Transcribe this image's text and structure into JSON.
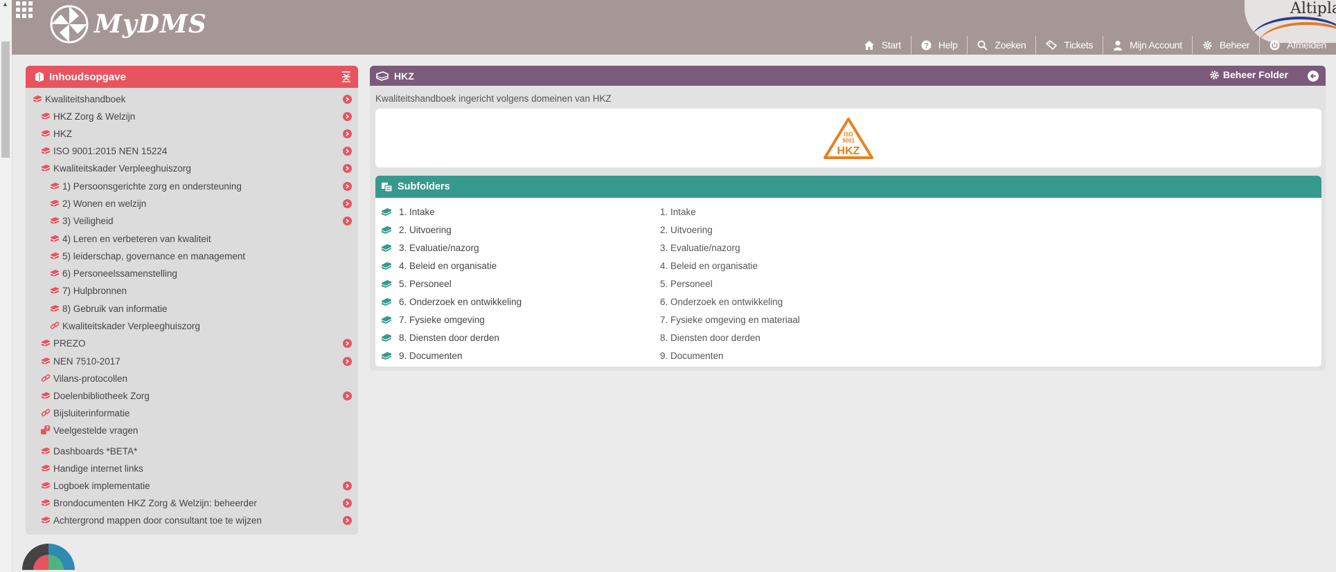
{
  "app": {
    "name": "MyDMS",
    "partner": "Altiplano"
  },
  "nav": [
    {
      "label": "Start",
      "icon": "home-icon"
    },
    {
      "label": "Help",
      "icon": "help-icon"
    },
    {
      "label": "Zoeken",
      "icon": "search-icon"
    },
    {
      "label": "Tickets",
      "icon": "ticket-icon"
    },
    {
      "label": "Mijn Account",
      "icon": "user-icon"
    },
    {
      "label": "Beheer",
      "icon": "gear-icon"
    },
    {
      "label": "Afmelden",
      "icon": "power-icon"
    }
  ],
  "toc": {
    "title": "Inhoudsopgave",
    "items": [
      {
        "label": "Kwaliteitshandboek",
        "level": 0,
        "icon": "book-icon",
        "arrow": true
      },
      {
        "label": "HKZ Zorg & Welzijn",
        "level": 1,
        "icon": "book-icon",
        "arrow": true
      },
      {
        "label": "HKZ",
        "level": 1,
        "icon": "book-icon",
        "arrow": true
      },
      {
        "label": "ISO 9001:2015 NEN 15224",
        "level": 1,
        "icon": "book-icon",
        "arrow": true
      },
      {
        "label": "Kwaliteitskader Verpleeghuiszorg",
        "level": 1,
        "icon": "book-icon",
        "arrow": true
      },
      {
        "label": "1) Persoonsgerichte zorg en ondersteuning",
        "level": 2,
        "icon": "book-icon",
        "arrow": true
      },
      {
        "label": "2) Wonen en welzijn",
        "level": 2,
        "icon": "book-icon",
        "arrow": true
      },
      {
        "label": "3) Veiligheid",
        "level": 2,
        "icon": "book-icon",
        "arrow": true
      },
      {
        "label": "4) Leren en verbeteren van kwaliteit",
        "level": 2,
        "icon": "book-icon",
        "arrow": false
      },
      {
        "label": "5) leiderschap, governance en management",
        "level": 2,
        "icon": "book-icon",
        "arrow": false
      },
      {
        "label": "6) Personeelssamenstelling",
        "level": 2,
        "icon": "book-icon",
        "arrow": false
      },
      {
        "label": "7) Hulpbronnen",
        "level": 2,
        "icon": "book-icon",
        "arrow": false
      },
      {
        "label": "8) Gebruik van informatie",
        "level": 2,
        "icon": "book-icon",
        "arrow": false
      },
      {
        "label": "Kwaliteitskader Verpleeghuiszorg",
        "level": 2,
        "icon": "link-icon",
        "arrow": false
      },
      {
        "label": "PREZO",
        "level": 1,
        "icon": "book-icon",
        "arrow": true
      },
      {
        "label": "NEN 7510-2017",
        "level": 1,
        "icon": "book-icon",
        "arrow": true
      },
      {
        "label": "Vilans-protocollen",
        "level": 1,
        "icon": "link-icon",
        "arrow": false
      },
      {
        "label": "Doelenbibliotheek Zorg",
        "level": 1,
        "icon": "book-icon",
        "arrow": true
      },
      {
        "label": "Bijsluiterinformatie",
        "level": 1,
        "icon": "link-icon",
        "arrow": false
      },
      {
        "label": "Veelgestelde vragen",
        "level": 1,
        "icon": "faq-icon",
        "arrow": false
      },
      {
        "label": "Dashboards *BETA*",
        "level": 1,
        "icon": "book-icon",
        "arrow": false
      },
      {
        "label": "Handige internet links",
        "level": 1,
        "icon": "book-icon",
        "arrow": false
      },
      {
        "label": "Logboek implementatie",
        "level": 1,
        "icon": "book-icon",
        "arrow": true
      },
      {
        "label": "Brondocumenten HKZ Zorg & Welzijn: beheerder",
        "level": 1,
        "icon": "book-icon",
        "arrow": true
      },
      {
        "label": "Achtergrond mappen door consultant toe te wijzen",
        "level": 1,
        "icon": "book-icon",
        "arrow": true
      }
    ]
  },
  "folder": {
    "title": "HKZ",
    "manage_label": "Beheer Folder",
    "description": "Kwaliteitshandboek ingericht volgens domeinen van HKZ",
    "logo": {
      "line1": "ISO",
      "line2": "9001",
      "line3": "HKZ"
    },
    "subfolders_title": "Subfolders",
    "subfolders": [
      {
        "name": "1. Intake",
        "description": "1. Intake"
      },
      {
        "name": "2. Uitvoering",
        "description": "2. Uitvoering"
      },
      {
        "name": "3. Evaluatie/nazorg",
        "description": "3. Evaluatie/nazorg"
      },
      {
        "name": "4. Beleid en organisatie",
        "description": "4. Beleid en organisatie"
      },
      {
        "name": "5. Personeel",
        "description": "5. Personeel"
      },
      {
        "name": "6. Onderzoek en ontwikkeling",
        "description": "6. Onderzoek en ontwikkeling"
      },
      {
        "name": "7. Fysieke omgeving",
        "description": "7. Fysieke omgeving en materiaal"
      },
      {
        "name": "8. Diensten door derden",
        "description": "8. Diensten door derden"
      },
      {
        "name": "9. Documenten",
        "description": "9. Documenten"
      }
    ]
  },
  "colors": {
    "toc_accent": "#e7545f",
    "folder_header": "#7b5a7a",
    "subfolder_header": "#36998e",
    "header_bg": "#a49796"
  }
}
